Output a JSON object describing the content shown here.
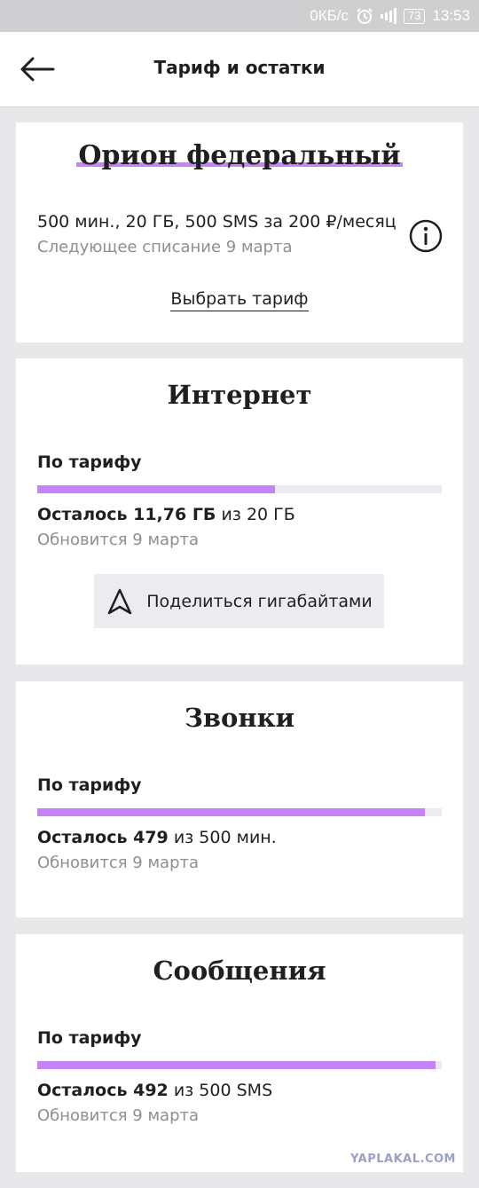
{
  "status_bar": {
    "speed": "0КБ/с",
    "battery": "73",
    "time": "13:53"
  },
  "header": {
    "title": "Тариф и остатки",
    "back_icon": "arrow-left-icon"
  },
  "plan": {
    "name": "Орион федеральный",
    "summary": "500 мин., 20 ГБ, 500 SMS за 200 ₽/месяц",
    "next_charge": "Следующее списание 9 марта",
    "choose_label": "Выбрать тариф",
    "info_icon": "info-icon"
  },
  "internet": {
    "title": "Интернет",
    "label": "По тарифу",
    "remaining_prefix": "Осталось 11,76 ГБ",
    "remaining_suffix": " из 20 ГБ",
    "renew": "Обновится 9 марта",
    "share_label": "Поделиться гигабайтами",
    "share_icon": "navigation-arrow-icon",
    "remaining_fraction": 0.588
  },
  "calls": {
    "title": "Звонки",
    "label": "По тарифу",
    "remaining_prefix": "Осталось 479",
    "remaining_suffix": " из 500 мин.",
    "renew": "Обновится 9 марта",
    "remaining_fraction": 0.958
  },
  "sms": {
    "title": "Сообщения",
    "label": "По тарифу",
    "remaining_prefix": "Осталось 492",
    "remaining_suffix": " из 500 SMS",
    "renew": "Обновится 9 марта",
    "remaining_fraction": 0.984
  },
  "watermark": "YAPLAKAL.COM",
  "colors": {
    "accent": "#c483f7",
    "track": "#ececf0",
    "background": "#e8e8eb",
    "secondary_text": "#8e8e93"
  }
}
